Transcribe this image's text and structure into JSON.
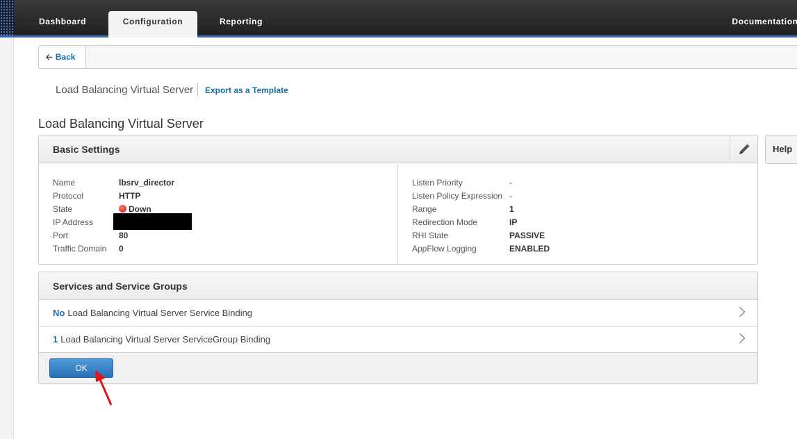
{
  "nav": {
    "tabs": [
      "Dashboard",
      "Configuration",
      "Reporting",
      "Documentation"
    ],
    "active": "Configuration"
  },
  "toolbar": {
    "back_label": "Back"
  },
  "breadcrumb": {
    "title": "Load Balancing Virtual Server",
    "export_label": "Export as a Template"
  },
  "page": {
    "title": "Load Balancing Virtual Server"
  },
  "basic_settings": {
    "header": "Basic Settings",
    "help_label": "Help",
    "left": [
      {
        "label": "Name",
        "value": "lbsrv_director"
      },
      {
        "label": "Protocol",
        "value": "HTTP"
      },
      {
        "label": "State",
        "value": "Down"
      },
      {
        "label": "IP Address",
        "value": ""
      },
      {
        "label": "Port",
        "value": "80"
      },
      {
        "label": "Traffic Domain",
        "value": "0"
      }
    ],
    "right": [
      {
        "label": "Listen Priority",
        "value": "-"
      },
      {
        "label": "Listen Policy Expression",
        "value": "-"
      },
      {
        "label": "Range",
        "value": "1"
      },
      {
        "label": "Redirection Mode",
        "value": "IP"
      },
      {
        "label": "RHI State",
        "value": "PASSIVE"
      },
      {
        "label": "AppFlow Logging",
        "value": "ENABLED"
      }
    ]
  },
  "services": {
    "header": "Services and Service Groups",
    "rows": [
      {
        "count": "No",
        "label": "Load Balancing Virtual Server Service Binding"
      },
      {
        "count": "1",
        "label": "Load Balancing Virtual Server ServiceGroup Binding"
      }
    ],
    "ok_label": "OK"
  },
  "colors": {
    "accent": "#3d6fb6",
    "link": "#1a6fb0",
    "state_down": "#c81a10",
    "annotation_arrow": "#e0141b"
  }
}
